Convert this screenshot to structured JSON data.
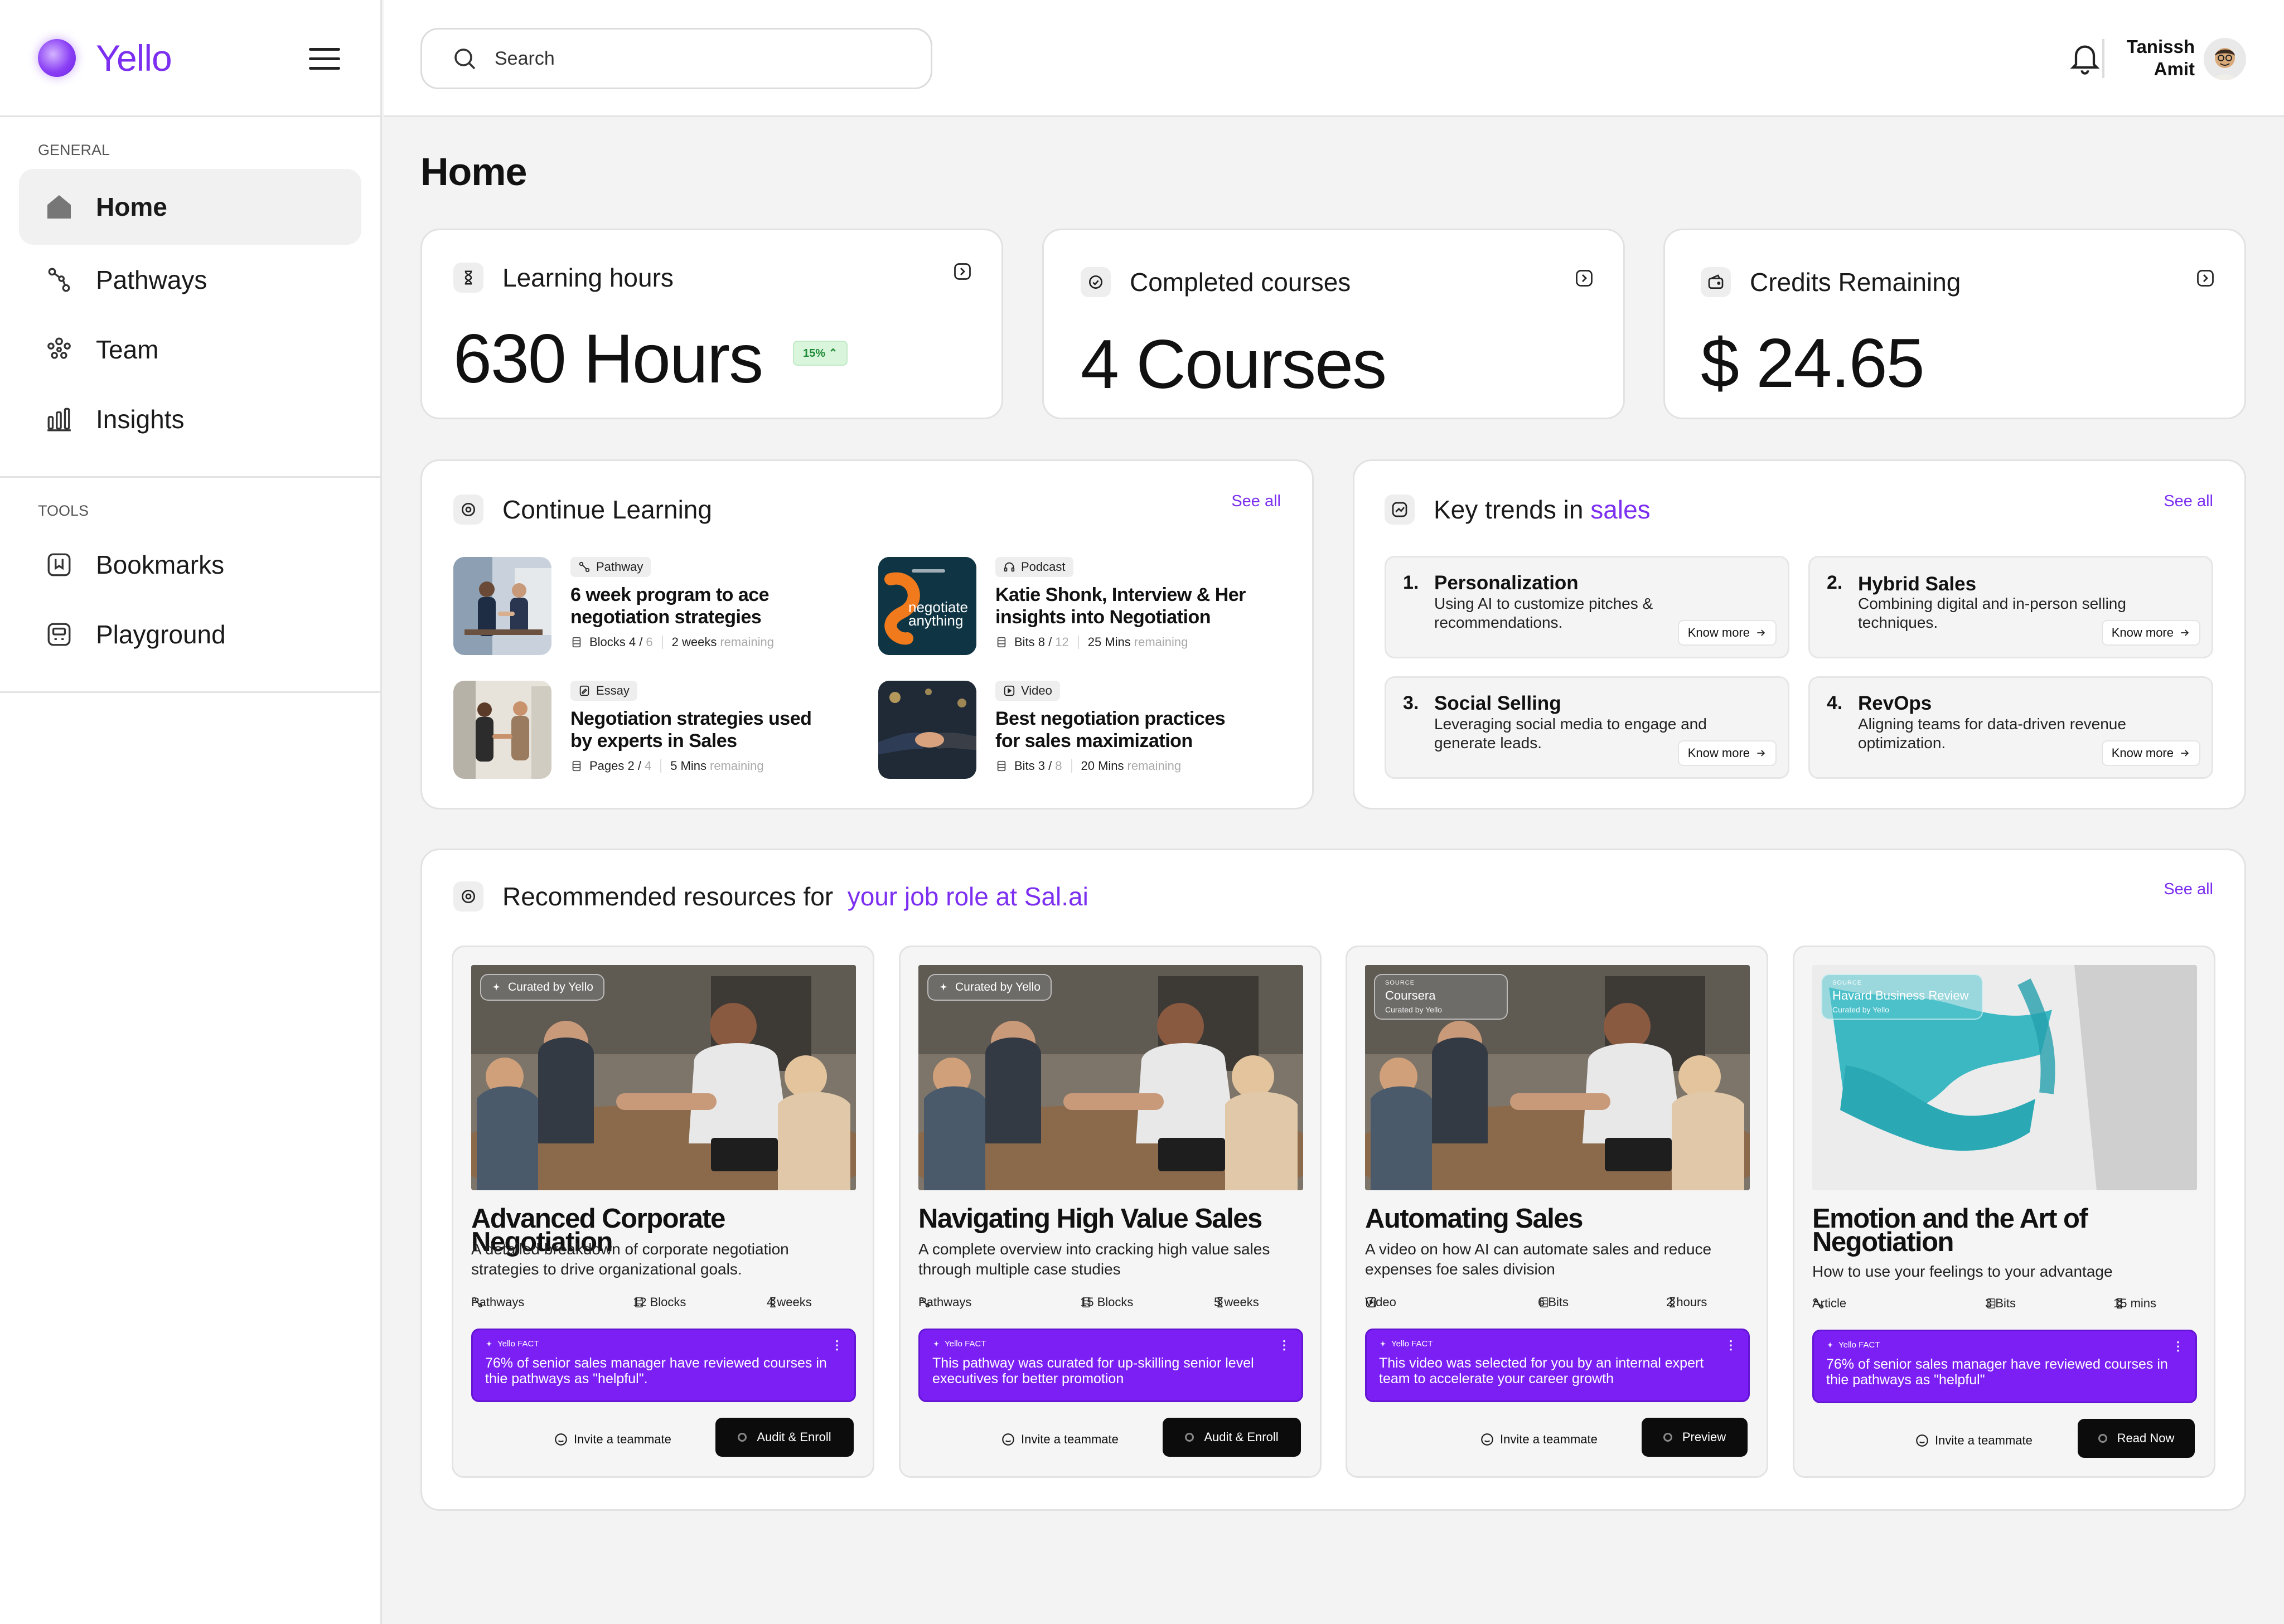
{
  "app": {
    "logo_text": "Yello"
  },
  "search": {
    "placeholder": "Search"
  },
  "user": {
    "first_name": "Tanissh",
    "last_name": "Amit"
  },
  "sidebar": {
    "general_heading": "GENERAL",
    "tools_heading": "TOOLS",
    "general_items": [
      {
        "label": "Home",
        "icon": "home-icon"
      },
      {
        "label": "Pathways",
        "icon": "pathways-icon"
      },
      {
        "label": "Team",
        "icon": "team-icon"
      },
      {
        "label": "Insights",
        "icon": "insights-icon"
      }
    ],
    "tool_items": [
      {
        "label": "Bookmarks",
        "icon": "bookmark-icon"
      },
      {
        "label": "Playground",
        "icon": "playground-icon"
      }
    ]
  },
  "page": {
    "title": "Home"
  },
  "stats": [
    {
      "label": "Learning hours",
      "value": "630 Hours",
      "badge": "15% ⌃"
    },
    {
      "label": "Completed courses",
      "value": "4 Courses"
    },
    {
      "label": "Credits Remaining",
      "value": "$ 24.65"
    }
  ],
  "continue_learning": {
    "title": "Continue Learning",
    "see_all": "See all",
    "items": [
      {
        "type": "Pathway",
        "title": "6 week program to ace negotiation strategies",
        "progress_label": "Blocks 4 /",
        "progress_total": "6",
        "remaining_value": "2 weeks",
        "remaining_word": "remaining"
      },
      {
        "type": "Podcast",
        "title": "Katie Shonk, Interview & Her insights into Negotiation",
        "progress_label": "Bits 8 /",
        "progress_total": "12",
        "remaining_value": "25 Mins",
        "remaining_word": "remaining",
        "thumb_text_1": "negotiate",
        "thumb_text_2": "anything"
      },
      {
        "type": "Essay",
        "title": "Negotiation strategies used by experts in Sales",
        "progress_label": "Pages 2 /",
        "progress_total": "4",
        "remaining_value": "5 Mins",
        "remaining_word": "remaining"
      },
      {
        "type": "Video",
        "title": "Best negotiation practices for sales maximization",
        "progress_label": "Bits 3 /",
        "progress_total": "8",
        "remaining_value": "20 Mins",
        "remaining_word": "remaining"
      }
    ]
  },
  "key_trends": {
    "title_prefix": "Key trends in",
    "title_highlight": "sales",
    "see_all": "See all",
    "know_more": "Know more",
    "items": [
      {
        "num": "1.",
        "title": "Personalization",
        "desc": "Using AI to customize pitches & recommendations."
      },
      {
        "num": "2.",
        "title": "Hybrid Sales",
        "desc": "Combining digital and in-person selling techniques."
      },
      {
        "num": "3.",
        "title": "Social Selling",
        "desc": "Leveraging social media to engage and generate leads."
      },
      {
        "num": "4.",
        "title": "RevOps",
        "desc": "Aligning teams for data-driven revenue optimization."
      }
    ]
  },
  "recommended": {
    "title_prefix": "Recommended resources for",
    "title_highlight": "your job role at Sal.ai",
    "see_all": "See all",
    "fact_label": "Yello FACT",
    "invite_label": "Invite a teammate",
    "cards": [
      {
        "tag": "Curated by Yello",
        "title": "Advanced Corporate Negotiation",
        "desc": "A detailed breakdown of corporate negotiation strategies to drive organizational goals.",
        "kind": "Pathways",
        "units": "12 Blocks",
        "duration": "4 weeks",
        "fact": "76% of senior sales manager have reviewed courses in thie pathways as \"helpful\".",
        "action": "Audit & Enroll"
      },
      {
        "tag": "Curated by Yello",
        "title": "Navigating High Value Sales",
        "desc": "A complete overview into cracking high value sales through multiple case studies",
        "kind": "Pathways",
        "units": "15 Blocks",
        "duration": "5 weeks",
        "fact": "This pathway was curated for up-skilling senior level executives for better promotion",
        "action": "Audit & Enroll"
      },
      {
        "source_label": "SOURCE",
        "source": "Coursera",
        "source_sub": "Curated by Yello",
        "title": "Automating Sales",
        "desc": "A video on how AI can automate sales and reduce expenses foe sales division",
        "kind": "Video",
        "units": "6 Bits",
        "duration": "2 hours",
        "fact": "This video was selected for you by an internal expert team to accelerate your career growth",
        "action": "Preview"
      },
      {
        "source_label": "SOURCE",
        "source": "Havard Business Review",
        "source_sub": "Curated by Yello",
        "title": "Emotion and the Art of Negotiation",
        "desc": "How to use your feelings to your advantage",
        "kind": "Article",
        "units": "3 Bits",
        "duration": "15 mins",
        "fact": "76% of senior sales manager have reviewed courses in thie pathways as \"helpful\"",
        "action": "Read Now"
      }
    ]
  },
  "colors": {
    "accent": "#7c2ff0",
    "fact_bg": "#7c1ff5",
    "button_dark": "#0c0c0c"
  }
}
